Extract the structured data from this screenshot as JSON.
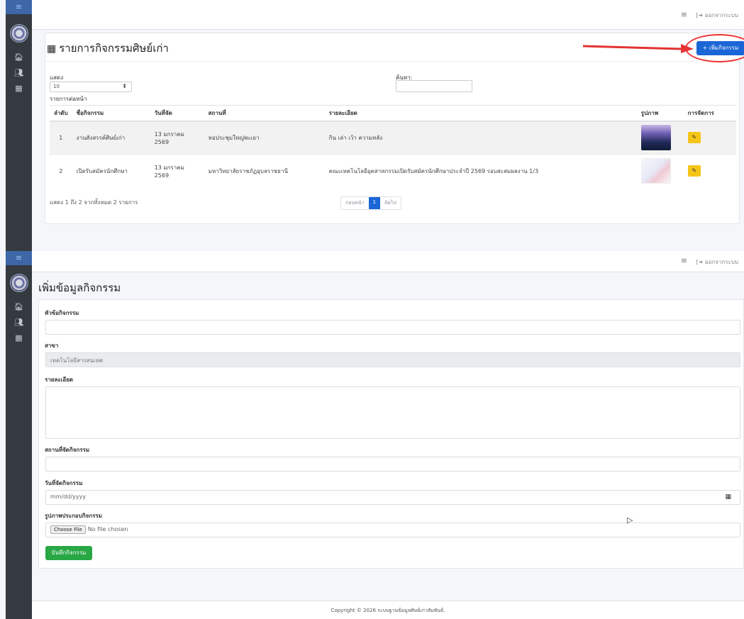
{
  "sidebar": {
    "menu_glyph": "≡",
    "items": [
      {
        "icon": "home-icon",
        "glyph": "🏠︎"
      },
      {
        "icon": "users-icon",
        "glyph": "👥︎"
      },
      {
        "icon": "calendar-icon",
        "glyph": "▦"
      }
    ]
  },
  "topbar": {
    "menu_glyph": "≡",
    "logout_label": "[➜ ออกจากระบบ"
  },
  "list_page": {
    "title": "รายการกิจกรรมศิษย์เก่า",
    "add_button_label": "+ เพิ่มกิจกรรม",
    "show_label": "แสดง",
    "show_value": "10",
    "per_page_label": "รายการต่อหน้า",
    "search_label": "ค้นหา:",
    "columns": [
      "ลำดับ",
      "ชื่อกิจกรรม",
      "วันที่จัด",
      "สถานที่",
      "รายละเอียด",
      "รูปภาพ",
      "การจัดการ"
    ],
    "rows": [
      {
        "no": "1",
        "name": "งานสังสรรค์ศิษย์เก่า",
        "date": "13 มกราคม 2569",
        "place": "หอประชุมใหญ่พะเยา",
        "detail": "กิน เล่า เว้า ความหลัง"
      },
      {
        "no": "2",
        "name": "เปิดรับสมัครนักศึกษา",
        "date": "13 มกราคม 2569",
        "place": "มหาวิทยาลัยราชภัฏอุบลราชธานี",
        "detail": "คณะเทคโนโลยีอุตสาหกรรมเปิดรับสมัครนักศึกษาประจำปี 2569 รอบสะสมผลงาน 1/3"
      }
    ],
    "footer_text": "แสดง 1 ถึง 2 จากทั้งหมด 2 รายการ",
    "pager": {
      "prev": "ก่อนหน้า",
      "current": "1",
      "next": "ถัดไป"
    }
  },
  "form_page": {
    "title": "เพิ่มข้อมูลกิจกรรม",
    "fields": {
      "topic_label": "หัวข้อกิจกรรม",
      "branch_label": "สาขา",
      "branch_value": "เทคโนโลยีสารสนเทศ",
      "detail_label": "รายละเอียด",
      "place_label": "สถานที่จัดกิจกรรม",
      "date_label": "วันที่จัดกิจกรรม",
      "date_placeholder": "mm/dd/yyyy",
      "image_label": "รูปภาพประกอบกิจกรรม",
      "choose_file": "Choose File",
      "no_file": "No file chosen"
    },
    "save_button_label": "บันทึกกิจกรรม"
  },
  "footer": {
    "copyright": "Copyright © 2026 ระบบฐานข้อมูลศิษย์เก่าสัมพันธ์."
  },
  "colors": {
    "primary": "#1a66d6",
    "success": "#28a745",
    "warning": "#f5c518",
    "sidebar": "#343a40",
    "annotation": "#e33333"
  }
}
